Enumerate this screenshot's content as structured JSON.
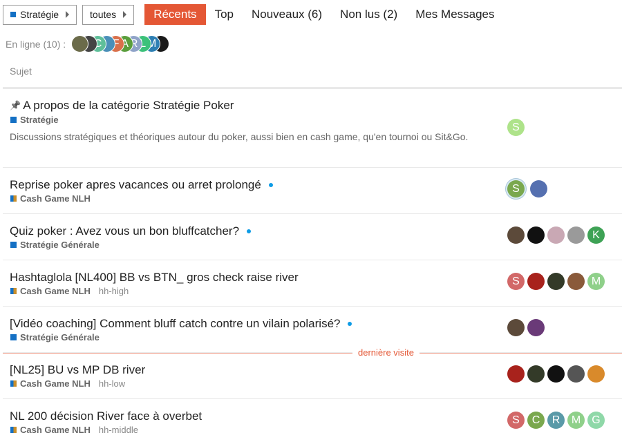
{
  "nav": {
    "category_dropdown": {
      "label": "Stratégie",
      "color": "#1470c4"
    },
    "subcategory_dropdown": {
      "label": "toutes"
    },
    "tabs": [
      {
        "label": "Récents",
        "active": true
      },
      {
        "label": "Top",
        "active": false
      },
      {
        "label": "Nouveaux (6)",
        "active": false
      },
      {
        "label": "Non lus (2)",
        "active": false
      },
      {
        "label": "Mes Messages",
        "active": false
      }
    ]
  },
  "online": {
    "label": "En ligne (10) :",
    "avatars": [
      {
        "letter": "",
        "color": "#6b6b4a"
      },
      {
        "letter": "",
        "color": "#444444"
      },
      {
        "letter": "C",
        "color": "#5fbf9a"
      },
      {
        "letter": "",
        "color": "#4a8fb8"
      },
      {
        "letter": "F",
        "color": "#d9704b"
      },
      {
        "letter": "A",
        "color": "#5a9e3c"
      },
      {
        "letter": "R",
        "color": "#8fa3c8"
      },
      {
        "letter": "L",
        "color": "#3cc17a"
      },
      {
        "letter": "M",
        "color": "#2d7fb3"
      },
      {
        "letter": "",
        "color": "#1a1a1a"
      }
    ]
  },
  "list_header": {
    "subject": "Sujet"
  },
  "last_visit_label": "dernière visite",
  "topics": [
    {
      "title": "A propos de la catégorie Stratégie Poker",
      "pinned": true,
      "unread": false,
      "category": "Stratégie",
      "category_color": "#1470c4",
      "tag": "",
      "excerpt": "Discussions stratégiques et théoriques autour du poker, aussi bien en cash game, qu'en tournoi ou Sit&Go.",
      "avatars": [
        {
          "letter": "S",
          "color": "#aee38a"
        }
      ]
    },
    {
      "title": "Reprise poker apres vacances ou arret prolongé",
      "pinned": false,
      "unread": true,
      "category": "Cash Game NLH",
      "category_color": "#c98e2a",
      "tag": "",
      "avatars": [
        {
          "letter": "S",
          "color": "#7aa84e",
          "ring": true
        },
        {
          "letter": "",
          "color": "#5570b0"
        }
      ]
    },
    {
      "title": "Quiz poker : Avez vous un bon bluffcatcher?",
      "pinned": false,
      "unread": true,
      "category": "Stratégie Générale",
      "category_color": "#1470c4",
      "tag": "",
      "avatars": [
        {
          "letter": "",
          "color": "#5c4a3a"
        },
        {
          "letter": "",
          "color": "#111111"
        },
        {
          "letter": "",
          "color": "#c9a8b4"
        },
        {
          "letter": "",
          "color": "#9a9a9a"
        },
        {
          "letter": "K",
          "color": "#3ea255"
        }
      ]
    },
    {
      "title": "Hashtaglola [NL400] BB vs BTN_ gros check raise river",
      "pinned": false,
      "unread": false,
      "category": "Cash Game NLH",
      "category_color": "#c98e2a",
      "tag": "hh-high",
      "avatars": [
        {
          "letter": "S",
          "color": "#d26868"
        },
        {
          "letter": "",
          "color": "#a8221c"
        },
        {
          "letter": "",
          "color": "#333a28"
        },
        {
          "letter": "",
          "color": "#8a5a3a"
        },
        {
          "letter": "M",
          "color": "#8fd08a"
        }
      ]
    },
    {
      "title": "[Vidéo coaching] Comment bluff catch contre un vilain polarisé?",
      "pinned": false,
      "unread": true,
      "category": "Stratégie Générale",
      "category_color": "#1470c4",
      "tag": "",
      "avatars": [
        {
          "letter": "",
          "color": "#5c4a3a"
        },
        {
          "letter": "",
          "color": "#6a3a78"
        }
      ]
    },
    {
      "title": "[NL25] BU vs MP DB river",
      "pinned": false,
      "unread": false,
      "category": "Cash Game NLH",
      "category_color": "#c98e2a",
      "tag": "hh-low",
      "avatars": [
        {
          "letter": "",
          "color": "#a8221c"
        },
        {
          "letter": "",
          "color": "#333a28"
        },
        {
          "letter": "",
          "color": "#111111"
        },
        {
          "letter": "",
          "color": "#555555"
        },
        {
          "letter": "",
          "color": "#d98a2b"
        }
      ]
    },
    {
      "title": "NL 200 décision River face à overbet",
      "pinned": false,
      "unread": false,
      "category": "Cash Game NLH",
      "category_color": "#c98e2a",
      "tag": "hh-middle",
      "avatars": [
        {
          "letter": "S",
          "color": "#d26868"
        },
        {
          "letter": "C",
          "color": "#7aa84e"
        },
        {
          "letter": "R",
          "color": "#5a9aa8"
        },
        {
          "letter": "M",
          "color": "#8fd08a"
        },
        {
          "letter": "G",
          "color": "#8fd8a8"
        }
      ]
    }
  ]
}
